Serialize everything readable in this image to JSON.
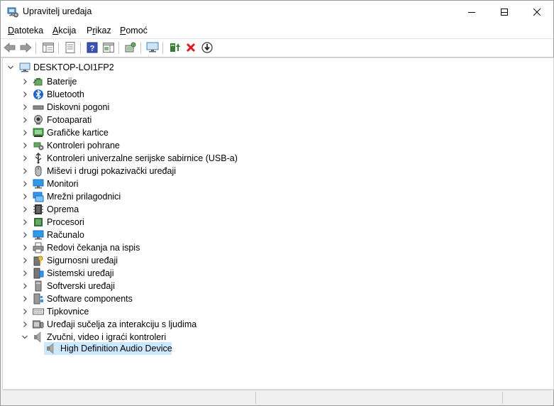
{
  "window": {
    "title": "Upravitelj uređaja",
    "app_icon": "device-manager-icon"
  },
  "menu": [
    {
      "pre": "",
      "u": "D",
      "post": "atoteka"
    },
    {
      "pre": "",
      "u": "A",
      "post": "kcija"
    },
    {
      "pre": "P",
      "u": "r",
      "post": "ikaz"
    },
    {
      "pre": "",
      "u": "P",
      "post": "omoć"
    }
  ],
  "toolbar_icons": [
    "back-arrow-icon",
    "forward-arrow-icon",
    "show-hide-console-tree-icon",
    "properties-icon",
    "help-icon",
    "action-pane-icon",
    "scan-hardware-icon",
    "monitor-icon",
    "update-driver-icon",
    "uninstall-device-icon",
    "disable-device-icon"
  ],
  "tree": {
    "root": {
      "label": "DESKTOP-LOI1FP2",
      "icon": "computer-icon"
    },
    "categories": [
      {
        "label": "Baterije",
        "icon": "battery-icon",
        "expanded": false
      },
      {
        "label": "Bluetooth",
        "icon": "bluetooth-icon",
        "expanded": false
      },
      {
        "label": "Diskovni pogoni",
        "icon": "disk-drive-icon",
        "expanded": false
      },
      {
        "label": "Fotoaparati",
        "icon": "camera-icon",
        "expanded": false
      },
      {
        "label": "Grafičke kartice",
        "icon": "display-adapter-icon",
        "expanded": false
      },
      {
        "label": "Kontroleri pohrane",
        "icon": "storage-controller-icon",
        "expanded": false
      },
      {
        "label": "Kontroleri univerzalne serijske sabirnice (USB-a)",
        "icon": "usb-icon",
        "expanded": false
      },
      {
        "label": "Miševi i drugi pokazivački uređaji",
        "icon": "mouse-icon",
        "expanded": false
      },
      {
        "label": "Monitori",
        "icon": "monitor-icon",
        "expanded": false
      },
      {
        "label": "Mrežni prilagodnici",
        "icon": "network-adapter-icon",
        "expanded": false
      },
      {
        "label": "Oprema",
        "icon": "firmware-icon",
        "expanded": false
      },
      {
        "label": "Procesori",
        "icon": "processor-icon",
        "expanded": false
      },
      {
        "label": "Računalo",
        "icon": "computer-icon",
        "expanded": false
      },
      {
        "label": "Redovi čekanja na ispis",
        "icon": "printer-icon",
        "expanded": false
      },
      {
        "label": "Sigurnosni uređaji",
        "icon": "security-device-icon",
        "expanded": false
      },
      {
        "label": "Sistemski uređaji",
        "icon": "system-device-icon",
        "expanded": false
      },
      {
        "label": "Softverski uređaji",
        "icon": "software-device-icon",
        "expanded": false
      },
      {
        "label": "Software components",
        "icon": "software-component-icon",
        "expanded": false
      },
      {
        "label": "Tipkovnice",
        "icon": "keyboard-icon",
        "expanded": false
      },
      {
        "label": "Uređaji sučelja za interakciju s ljudima",
        "icon": "hid-icon",
        "expanded": false
      },
      {
        "label": "Zvučni, video i igraći kontroleri",
        "icon": "speaker-icon",
        "expanded": true
      }
    ],
    "selected_child": {
      "label": "High Definition Audio Device",
      "icon": "speaker-icon"
    }
  }
}
